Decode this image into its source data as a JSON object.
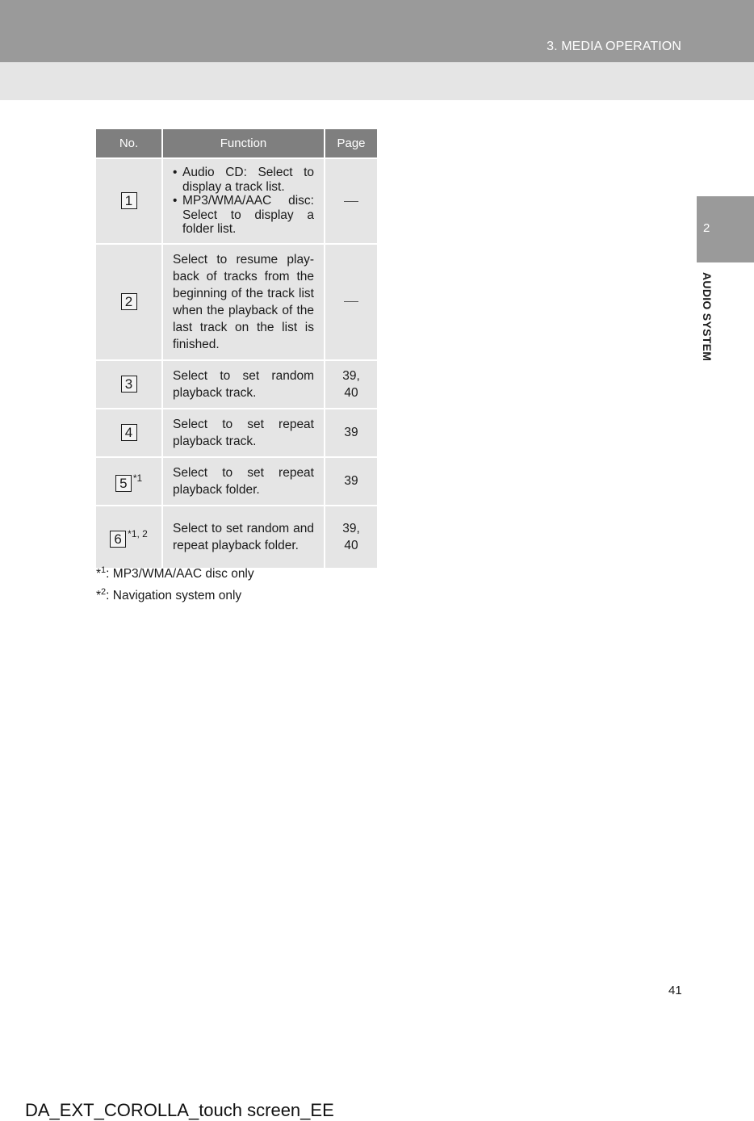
{
  "header": {
    "section_title": "3. MEDIA OPERATION"
  },
  "side_tab": {
    "chapter_number": "2",
    "chapter_label": "AUDIO SYSTEM"
  },
  "table": {
    "columns": [
      "No.",
      "Function",
      "Page"
    ],
    "rows": [
      {
        "no": "1",
        "note": "",
        "function_bullets": [
          "Audio CD: Select to display a track list.",
          "MP3/WMA/AAC disc: Select to display a folder list."
        ],
        "function": "",
        "page_line1": "",
        "page_line2": "",
        "page_dash": true
      },
      {
        "no": "2",
        "note": "",
        "function": "Select to resume play-back of tracks from the beginning of the track list when the playback of the last track on the list is finished.",
        "page_line1": "",
        "page_line2": "",
        "page_dash": true
      },
      {
        "no": "3",
        "note": "",
        "function": "Select to set random playback track.",
        "page_line1": "39,",
        "page_line2": "40",
        "page_dash": false
      },
      {
        "no": "4",
        "note": "",
        "function": "Select to set repeat playback track.",
        "page_line1": "39",
        "page_line2": "",
        "page_dash": false
      },
      {
        "no": "5",
        "note": "*1",
        "function": "Select to set repeat playback folder.",
        "page_line1": "39",
        "page_line2": "",
        "page_dash": false
      },
      {
        "no": "6",
        "note": "*1, 2",
        "function": "Select to set random and repeat playback folder.",
        "page_line1": "39,",
        "page_line2": "40",
        "page_dash": false
      }
    ]
  },
  "footnotes": [
    {
      "mark": "*",
      "sup": "1",
      "text": ": MP3/WMA/AAC disc only"
    },
    {
      "mark": "*",
      "sup": "2",
      "text": ": Navigation system only"
    }
  ],
  "page_number": "41",
  "doc_id": "DA_EXT_COROLLA_touch screen_EE"
}
